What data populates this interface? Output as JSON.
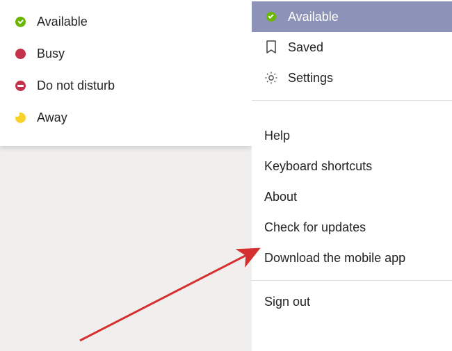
{
  "status_menu": {
    "items": [
      {
        "label": "Available",
        "icon": "available"
      },
      {
        "label": "Busy",
        "icon": "busy"
      },
      {
        "label": "Do not disturb",
        "icon": "dnd"
      },
      {
        "label": "Away",
        "icon": "away"
      }
    ]
  },
  "main_menu": {
    "top": [
      {
        "label": "Available",
        "icon": "available",
        "selected": true
      },
      {
        "label": "Saved",
        "icon": "bookmark"
      },
      {
        "label": "Settings",
        "icon": "gear"
      }
    ],
    "middle": [
      {
        "label": "Help"
      },
      {
        "label": "Keyboard shortcuts"
      },
      {
        "label": "About"
      },
      {
        "label": "Check for updates"
      },
      {
        "label": "Download the mobile app"
      }
    ],
    "bottom": [
      {
        "label": "Sign out"
      }
    ]
  },
  "colors": {
    "selected_bg": "#8c92b8",
    "available": "#6bb700",
    "busy": "#c4314b",
    "away": "#f8d22a",
    "arrow": "#d62f2f"
  }
}
